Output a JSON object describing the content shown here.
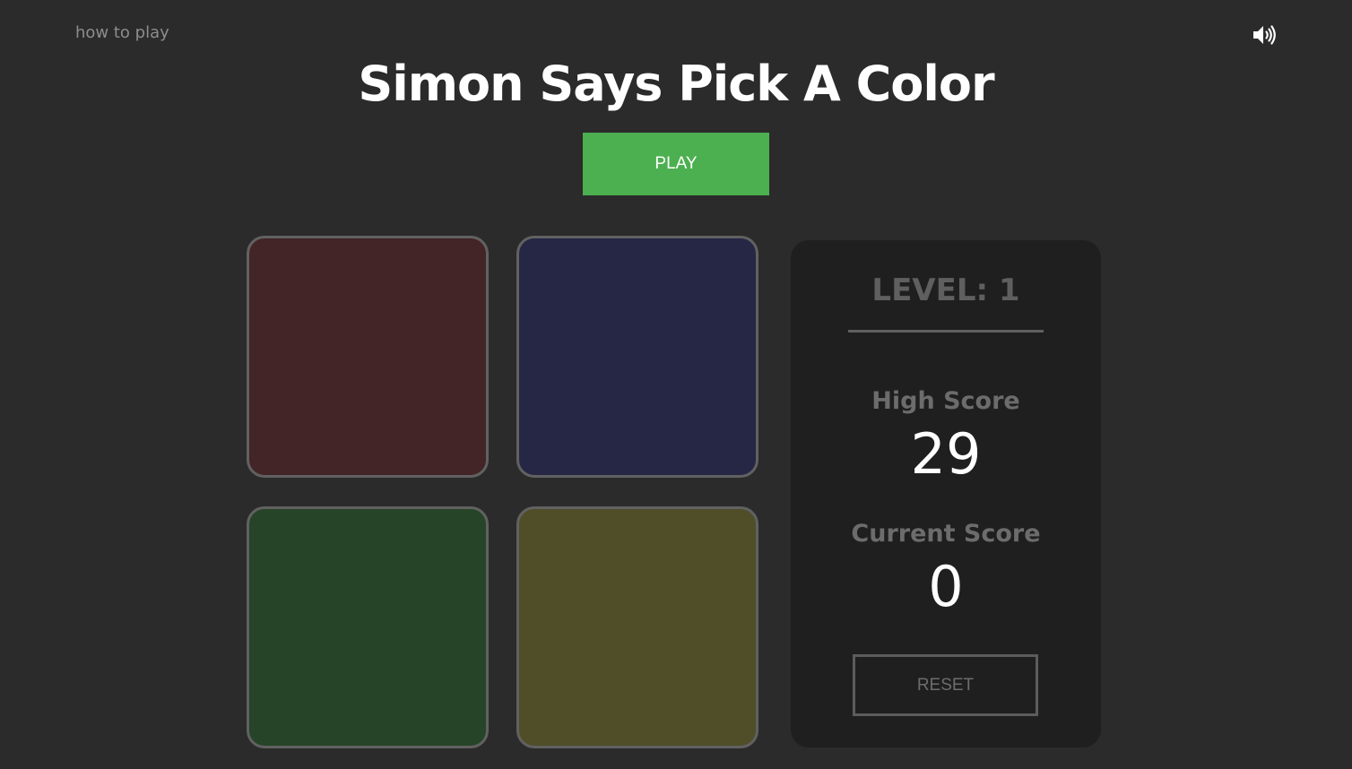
{
  "header": {
    "how_to_play": "how to play",
    "sound_icon": "speaker-volume-icon",
    "title": "Simon Says Pick A Color"
  },
  "controls": {
    "play_label": "PLAY",
    "play_color": "#4caf50"
  },
  "pads": [
    {
      "name": "red",
      "color": "#432527"
    },
    {
      "name": "blue",
      "color": "#262745"
    },
    {
      "name": "green",
      "color": "#264427"
    },
    {
      "name": "yellow",
      "color": "#4f4e29"
    }
  ],
  "scoreboard": {
    "level": "LEVEL: 1",
    "high_score_label": "High Score",
    "high_score": "29",
    "current_score_label": "Current Score",
    "current_score": "0",
    "reset_label": "RESET"
  }
}
